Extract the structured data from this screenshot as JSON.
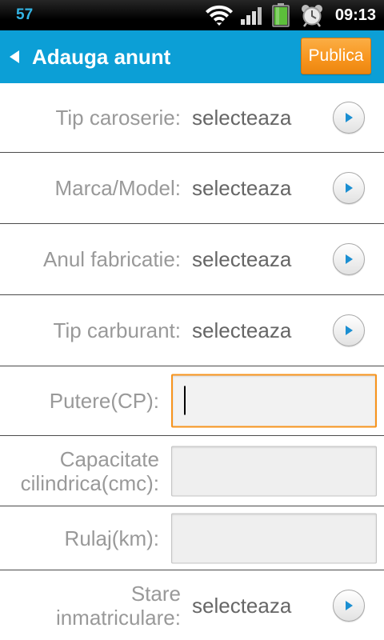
{
  "status_bar": {
    "notification_count": "57",
    "time": "09:13",
    "icons": {
      "wifi": "wifi-icon",
      "signal": "signal-icon",
      "battery": "battery-icon",
      "alarm": "alarm-clock-icon"
    }
  },
  "action_bar": {
    "back_icon": "back-arrow-icon",
    "title": "Adauga anunt",
    "publish_button": "Publica"
  },
  "form": {
    "rows": [
      {
        "label": "Tip caroserie:",
        "value": "selecteaza",
        "button_icon": "arrow-right-circle-icon"
      },
      {
        "label": "Marca/Model:",
        "value": "selecteaza",
        "button_icon": "arrow-right-circle-icon"
      },
      {
        "label": "Anul fabricatie:",
        "value": "selecteaza",
        "button_icon": "arrow-right-circle-icon"
      },
      {
        "label": "Tip carburant:",
        "value": "selecteaza",
        "button_icon": "arrow-right-circle-icon"
      },
      {
        "label": "Putere(CP):",
        "value": "",
        "focused": true
      },
      {
        "label_lines": [
          "Capacitate",
          "cilindrica(cmc):"
        ],
        "value": "",
        "focused": false
      },
      {
        "label": "Rulaj(km):",
        "value": "",
        "focused": false
      },
      {
        "label_lines": [
          "Stare",
          "inmatriculare:"
        ],
        "value": "selecteaza",
        "button_icon": "arrow-right-circle-icon"
      }
    ]
  },
  "colors": {
    "status_bar_bg": "#000000",
    "notification_count": "#33b5e5",
    "action_bar_bg": "#0c9fd6",
    "publish_button_bg": "#f7941d",
    "label_text": "#999999",
    "value_text": "#666666",
    "focused_border": "#f7941d",
    "arrow_icon": "#1b8fd2",
    "battery_fill": "#5cbf3a"
  }
}
